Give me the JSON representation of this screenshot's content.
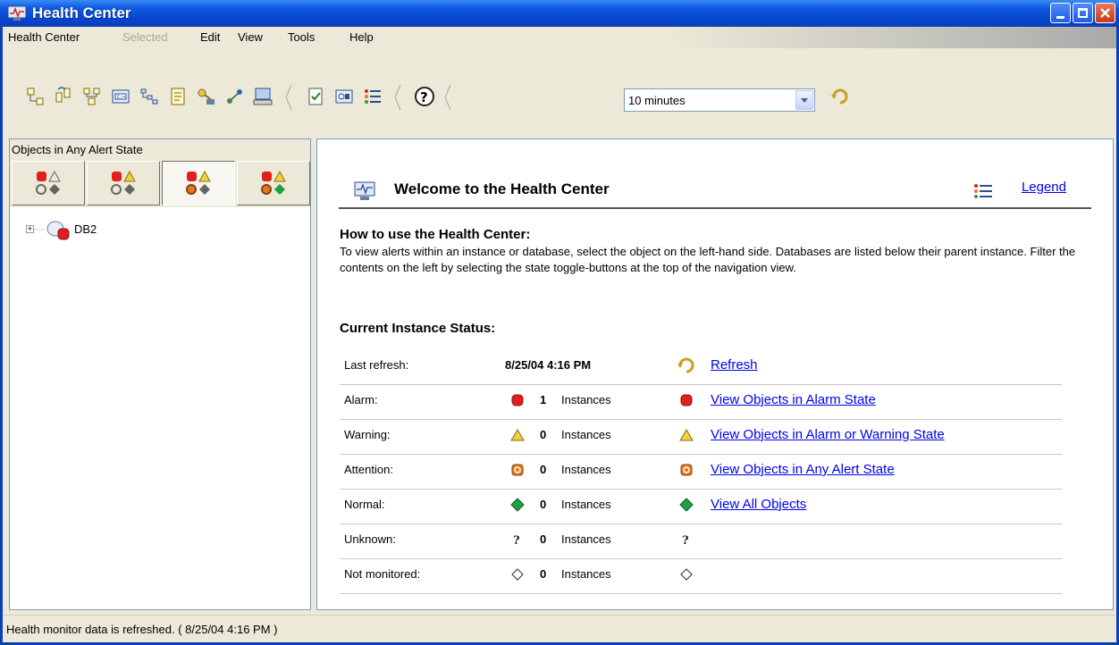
{
  "window": {
    "title": "Health Center"
  },
  "menu": {
    "items": [
      "Health Center",
      "Selected",
      "Edit",
      "View",
      "Tools",
      "Help"
    ]
  },
  "toolbar": {
    "interval": {
      "value": "10 minutes"
    }
  },
  "left": {
    "header": "Objects in Any Alert State",
    "tree_root": "DB2"
  },
  "main": {
    "welcome_title": "Welcome to the Health Center",
    "legend_link": "Legend",
    "howto_title": "How to use the Health Center:",
    "howto_text": "To view alerts within an instance or database, select the object on the left-hand side. Databases are listed below their parent instance. Filter the contents on the left by selecting the state toggle-buttons at the top of the navigation view.",
    "status_title": "Current Instance Status:",
    "last_refresh_label": "Last refresh:",
    "last_refresh_value": "8/25/04 4:16 PM",
    "refresh_link": "Refresh",
    "rows": [
      {
        "label": "Alarm:",
        "count": "1",
        "unit": "Instances",
        "link": "View Objects in Alarm State",
        "icon": "alarm-icon"
      },
      {
        "label": "Warning:",
        "count": "0",
        "unit": "Instances",
        "link": "View Objects in Alarm or Warning State",
        "icon": "warning-icon"
      },
      {
        "label": "Attention:",
        "count": "0",
        "unit": "Instances",
        "link": "View Objects in Any Alert State",
        "icon": "attention-icon"
      },
      {
        "label": "Normal:",
        "count": "0",
        "unit": "Instances",
        "link": "View All Objects",
        "icon": "normal-icon"
      },
      {
        "label": "Unknown:",
        "count": "0",
        "unit": "Instances",
        "link": "",
        "icon": "unknown-icon"
      },
      {
        "label": "Not monitored:",
        "count": "0",
        "unit": "Instances",
        "link": "",
        "icon": "not-monitored-icon"
      }
    ]
  },
  "statusbar": {
    "text": "Health monitor data is refreshed. ( 8/25/04 4:16 PM )"
  },
  "colors": {
    "alarm": "#e02020",
    "warning": "#f0d040",
    "attention": "#e07a20",
    "normal": "#20a040",
    "link": "#0000ee"
  }
}
